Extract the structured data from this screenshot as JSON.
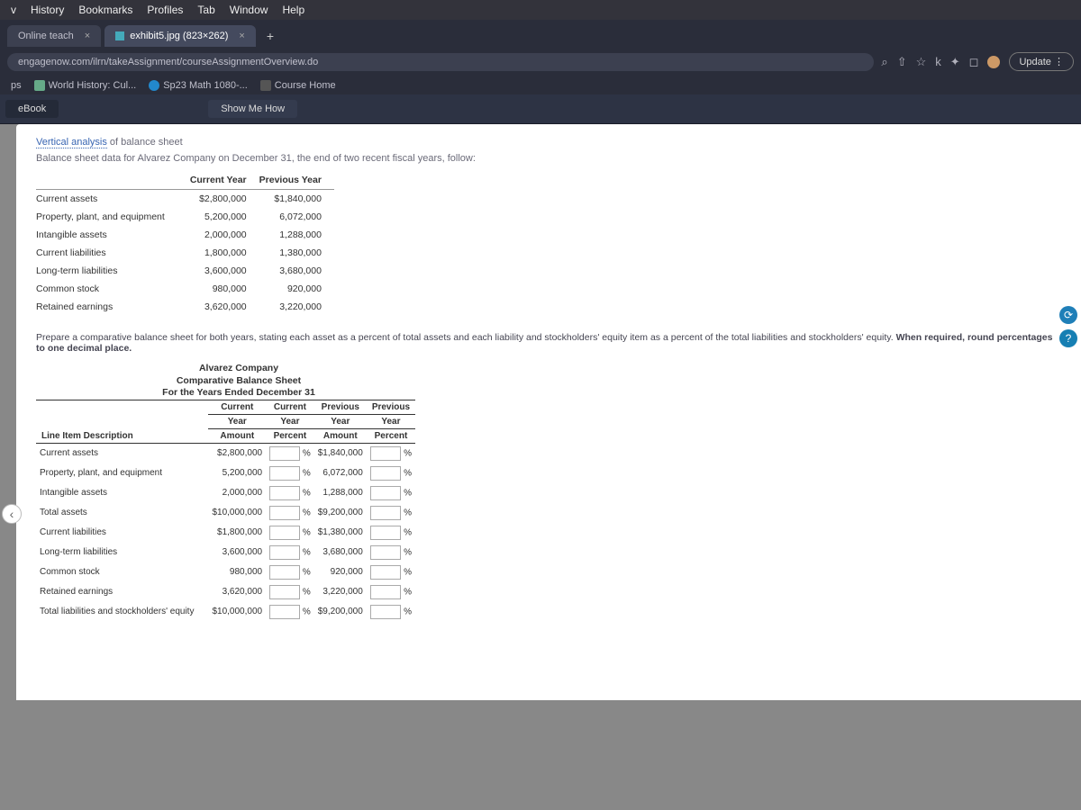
{
  "menu": {
    "items": [
      "v",
      "History",
      "Bookmarks",
      "Profiles",
      "Tab",
      "Window",
      "Help"
    ]
  },
  "tabs": [
    {
      "label": "Online teach",
      "active": false
    },
    {
      "label": "exhibit5.jpg (823×262)",
      "active": true
    }
  ],
  "new_tab": "+",
  "url": "engagenow.com/ilrn/takeAssignment/courseAssignmentOverview.do",
  "toolbar": {
    "update": "Update"
  },
  "bookmarks": [
    {
      "label": "ps"
    },
    {
      "label": "World History: Cul..."
    },
    {
      "label": "Sp23 Math 1080-..."
    },
    {
      "label": "Course Home"
    }
  ],
  "app": {
    "ebook": "eBook",
    "show_me": "Show Me How"
  },
  "heading": {
    "term": "Vertical analysis",
    "rest": " of balance sheet",
    "sub": "Balance sheet data for Alvarez Company on December 31, the end of two recent fiscal years, follow:"
  },
  "data_table": {
    "headers": [
      "",
      "Current Year",
      "Previous Year"
    ],
    "rows": [
      {
        "label": "Current assets",
        "cy": "$2,800,000",
        "py": "$1,840,000"
      },
      {
        "label": "Property, plant, and equipment",
        "cy": "5,200,000",
        "py": "6,072,000"
      },
      {
        "label": "Intangible assets",
        "cy": "2,000,000",
        "py": "1,288,000"
      },
      {
        "label": "Current liabilities",
        "cy": "1,800,000",
        "py": "1,380,000"
      },
      {
        "label": "Long-term liabilities",
        "cy": "3,600,000",
        "py": "3,680,000"
      },
      {
        "label": "Common stock",
        "cy": "980,000",
        "py": "920,000"
      },
      {
        "label": "Retained earnings",
        "cy": "3,620,000",
        "py": "3,220,000"
      }
    ]
  },
  "instruction": {
    "text": "Prepare a comparative balance sheet for both years, stating each asset as a percent of total assets and each liability and stockholders' equity item as a percent of the total liabilities and stockholders' equity. ",
    "bold": "When required, round percentages to one decimal place."
  },
  "comp_sheet": {
    "title1": "Alvarez Company",
    "title2": "Comparative Balance Sheet",
    "title3": "For the Years Ended December 31",
    "headers": [
      "Line Item Description",
      "Current Year Amount",
      "Current Year Percent",
      "Previous Year Amount",
      "Previous Year Percent"
    ],
    "h_line1": [
      "",
      "Current",
      "Current",
      "Previous",
      "Previous"
    ],
    "h_line2": [
      "",
      "Year",
      "Year",
      "Year",
      "Year"
    ],
    "h_line3": [
      "Line Item Description",
      "Amount",
      "Percent",
      "Amount",
      "Percent"
    ],
    "rows": [
      {
        "label": "Current assets",
        "cya": "$2,800,000",
        "pya": "$1,840,000"
      },
      {
        "label": "Property, plant, and equipment",
        "cya": "5,200,000",
        "pya": "6,072,000"
      },
      {
        "label": "Intangible assets",
        "cya": "2,000,000",
        "pya": "1,288,000"
      },
      {
        "label": "Total assets",
        "cya": "$10,000,000",
        "pya": "$9,200,000"
      },
      {
        "label": "Current liabilities",
        "cya": "$1,800,000",
        "pya": "$1,380,000"
      },
      {
        "label": "Long-term liabilities",
        "cya": "3,600,000",
        "pya": "3,680,000"
      },
      {
        "label": "Common stock",
        "cya": "980,000",
        "pya": "920,000"
      },
      {
        "label": "Retained earnings",
        "cya": "3,620,000",
        "pya": "3,220,000"
      },
      {
        "label": "Total liabilities and stockholders' equity",
        "cya": "$10,000,000",
        "pya": "$9,200,000"
      }
    ],
    "pct_suffix": "%"
  }
}
